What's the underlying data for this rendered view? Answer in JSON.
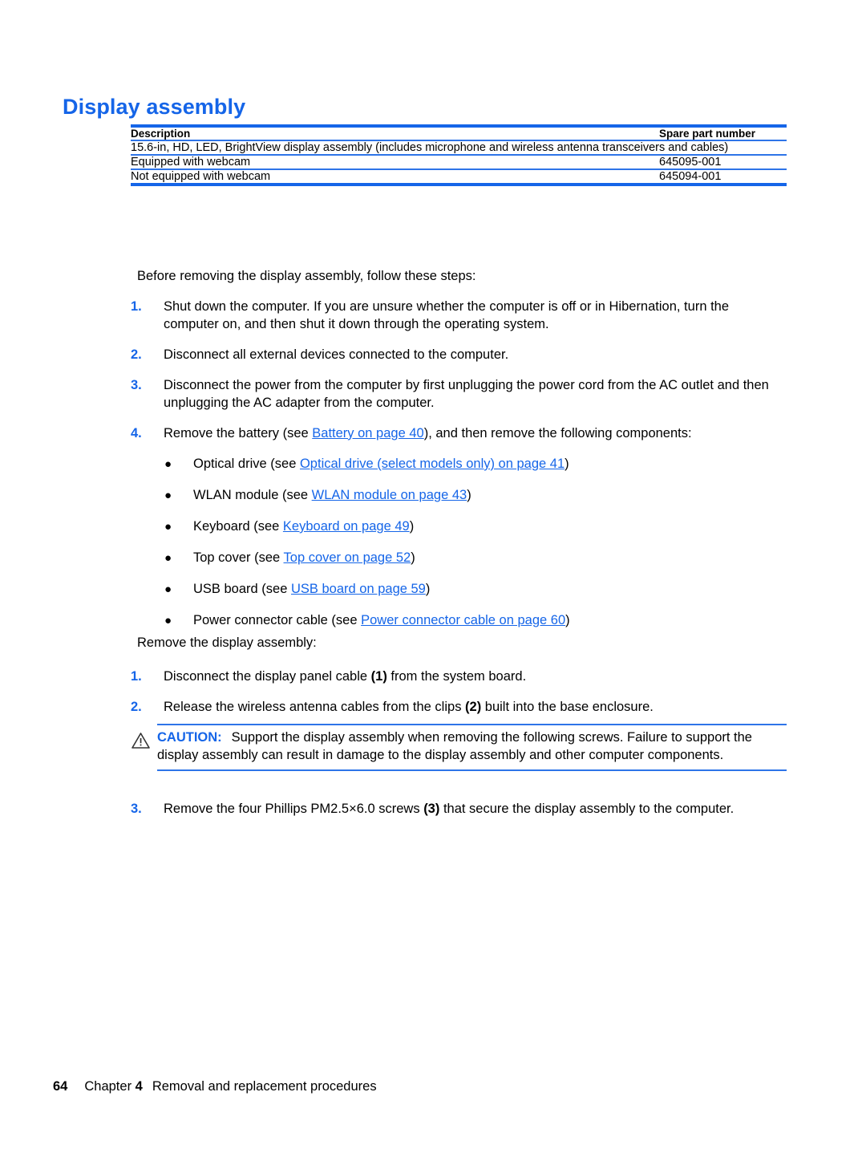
{
  "page": {
    "heading": "Display assembly",
    "accent_color": "#1565e8",
    "rule_color": "#2e74e8",
    "background": "#ffffff"
  },
  "spec_table": {
    "columns": [
      "Description",
      "Spare part number"
    ],
    "group_row": "15.6-in, HD, LED, BrightView display assembly (includes microphone and wireless antenna transceivers and cables)",
    "rows": [
      {
        "description": "Equipped with webcam",
        "spare_part_number": "645095-001"
      },
      {
        "description": "Not equipped with webcam",
        "spare_part_number": "645094-001"
      }
    ]
  },
  "intro": {
    "before_steps": "Before removing the display assembly, follow these steps:",
    "remove_steps": "Remove the display assembly:"
  },
  "before_steps": [
    {
      "num": "1.",
      "text": "Shut down the computer. If you are unsure whether the computer is off or in Hibernation, turn the computer on, and then shut it down through the operating system."
    },
    {
      "num": "2.",
      "text": "Disconnect all external devices connected to the computer."
    },
    {
      "num": "3.",
      "text": "Disconnect the power from the computer by first unplugging the power cord from the AC outlet and then unplugging the AC adapter from the computer."
    },
    {
      "num": "4.",
      "pre": "Remove the battery (see ",
      "link": "Battery on page 40",
      "post": "), and then remove the following components:"
    }
  ],
  "components": {
    "bullet_glyph": "●",
    "items": [
      {
        "pre": "Optical drive (see ",
        "link": "Optical drive (select models only) on page 41",
        "post": ")"
      },
      {
        "pre": "WLAN module (see ",
        "link": "WLAN module on page 43",
        "post": ")"
      },
      {
        "pre": "Keyboard (see ",
        "link": "Keyboard on page 49",
        "post": ")"
      },
      {
        "pre": "Top cover (see ",
        "link": "Top cover on page 52",
        "post": ")"
      },
      {
        "pre": "USB board (see ",
        "link": "USB board on page 59",
        "post": ")"
      },
      {
        "pre": "Power connector cable (see ",
        "link": "Power connector cable on page 60",
        "post": ")"
      }
    ]
  },
  "remove_steps": [
    {
      "num": "1.",
      "pre": "Disconnect the display panel cable ",
      "callout": "(1)",
      "post": " from the system board."
    },
    {
      "num": "2.",
      "pre": "Release the wireless antenna cables from the clips ",
      "callout": "(2)",
      "post": " built into the base enclosure."
    },
    {
      "num": "3.",
      "pre": "Remove the four Phillips PM2.5×6.0 screws ",
      "callout": "(3)",
      "post": " that secure the display assembly to the computer."
    }
  ],
  "caution": {
    "icon": "warning-triangle-icon",
    "label": "CAUTION:",
    "text": "Support the display assembly when removing the following screws. Failure to support the display assembly can result in damage to the display assembly and other computer components."
  },
  "footer": {
    "page_number": "64",
    "chapter_word": "Chapter",
    "chapter_number": "4",
    "title": "Removal and replacement procedures"
  }
}
